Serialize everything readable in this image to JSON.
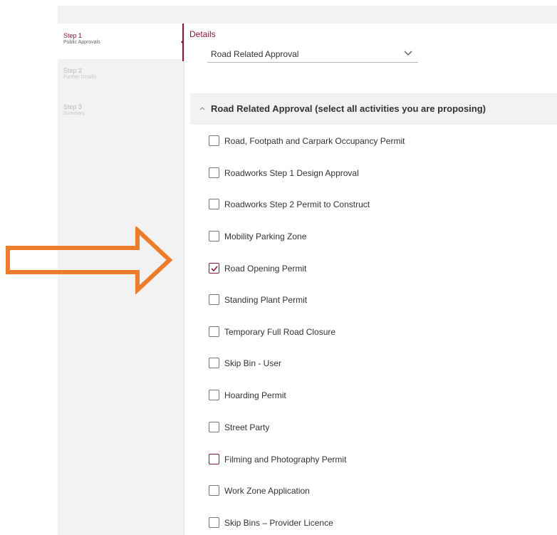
{
  "sidebar": {
    "steps": [
      {
        "title": "Step 1",
        "subtitle": "Public Approvals",
        "state": "active"
      },
      {
        "title": "Step 2",
        "subtitle": "Further Details",
        "state": "inactive"
      },
      {
        "title": "Step 3",
        "subtitle": "Summary",
        "state": "inactive"
      }
    ]
  },
  "details": {
    "label": "Details",
    "select_value": "Road Related Approval"
  },
  "section": {
    "title": "Road Related Approval (select all activities you are proposing)"
  },
  "options": [
    {
      "label": "Road, Footpath and Carpark Occupancy Permit",
      "checked": false
    },
    {
      "label": "Roadworks Step 1 Design Approval",
      "checked": false
    },
    {
      "label": "Roadworks Step 2 Permit to Construct",
      "checked": false
    },
    {
      "label": "Mobility Parking Zone",
      "checked": false
    },
    {
      "label": "Road Opening Permit",
      "checked": true
    },
    {
      "label": "Standing Plant Permit",
      "checked": false
    },
    {
      "label": "Temporary Full Road Closure",
      "checked": false
    },
    {
      "label": "Skip Bin - User",
      "checked": false
    },
    {
      "label": "Hoarding Permit",
      "checked": false
    },
    {
      "label": "Street Party",
      "checked": false
    },
    {
      "label": "Filming and Photography Permit",
      "checked": false,
      "highlighted": true
    },
    {
      "label": "Work Zone Application",
      "checked": false
    },
    {
      "label": "Skip Bins – Provider Licence",
      "checked": false
    }
  ],
  "colors": {
    "accent": "#8b1a38",
    "annotation_arrow": "#ee7d2b"
  },
  "icons": {
    "select": "chevron-down-icon",
    "section": "chevron-up-icon",
    "checked": "checkmark-icon",
    "annotation": "arrow-right-icon"
  }
}
